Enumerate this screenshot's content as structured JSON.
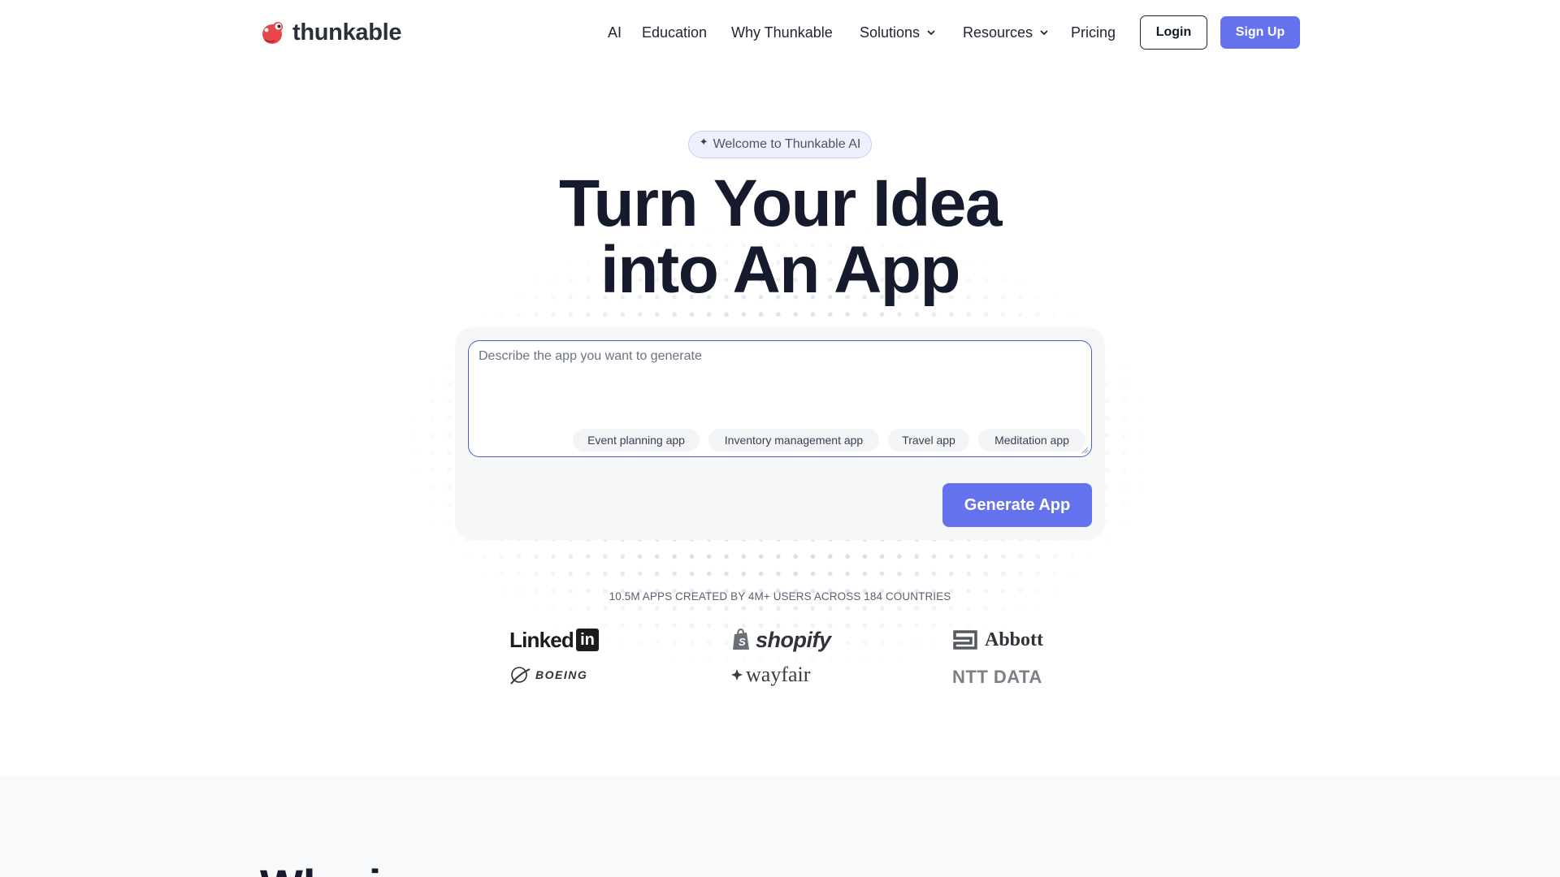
{
  "brand": {
    "name": "thunkable"
  },
  "nav": {
    "items": [
      {
        "label": "AI"
      },
      {
        "label": "Education"
      },
      {
        "label": "Why Thunkable"
      },
      {
        "label": "Solutions"
      },
      {
        "label": "Resources"
      },
      {
        "label": "Pricing"
      }
    ],
    "login_label": "Login",
    "signup_label": "Sign Up"
  },
  "hero": {
    "badge": "Welcome to Thunkable AI",
    "badge_icon": "sparkle-icon",
    "title_line1": "Turn Your Idea",
    "title_line2": "into An App",
    "prompt_placeholder": "Describe the app you want to generate",
    "prompt_value": "",
    "suggestions": [
      {
        "label": "Event planning app"
      },
      {
        "label": "Inventory management app"
      },
      {
        "label": "Travel app"
      },
      {
        "label": "Meditation app"
      }
    ],
    "generate_label": "Generate App"
  },
  "stats": {
    "text": "10.5M APPS CREATED BY 4M+ USERS ACROSS 184 COUNTRIES"
  },
  "logos": {
    "linkedin": {
      "text": "Linked",
      "badge": "in"
    },
    "shopify": "shopify",
    "abbott": "Abbott",
    "boeing": "BOEING",
    "wayfair": "wayfair",
    "nttdata": "NTT DATA"
  },
  "section2": {
    "title_partial": "Why i"
  },
  "colors": {
    "accent": "#6472ee",
    "title": "#151a2d",
    "badge_bg": "#eef0fd",
    "prompt_border": "#4c5bd4"
  }
}
